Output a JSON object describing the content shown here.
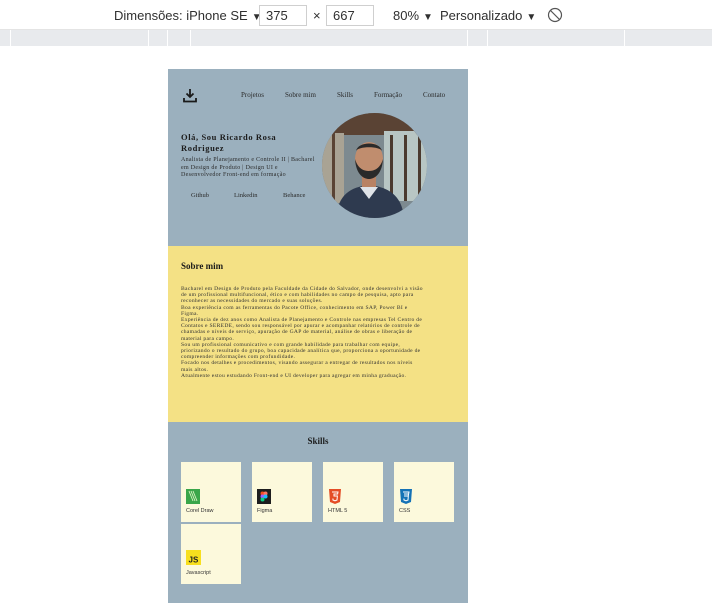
{
  "devtools": {
    "device_label": "Dimensões: iPhone SE",
    "width": "375",
    "height": "667",
    "separator": "×",
    "zoom": "80%",
    "throttle": "Personalizado"
  },
  "site": {
    "nav": [
      "Projetos",
      "Sobre mim",
      "Skills",
      "Formação",
      "Contato"
    ],
    "hero": {
      "title": "Olá, Sou Ricardo Rosa Rodriguez",
      "description": "Analista de Planejamento e Controle II | Bacharel em Design de Produto | Design UI e Desenvolvedor Front-end em formação",
      "social": [
        "Github",
        "Linkedin",
        "Behance"
      ]
    },
    "about": {
      "title": "Sobre mim",
      "paragraphs": [
        "Bacharel em Design de Produto pela Faculdade da Cidade do Salvador, onde desenvolvi a visão de um profissional multifuncional, ético e com habilidades no campo de pesquisa, apto para reconhecer as necessidades do mercado e suas soluções.",
        "Boa experiência com as ferramentas do Pacote Office, conhecimento em SAP, Power BI e Figma.",
        "Experiência de dez anos como Analista de Planejamento e Controle nas empresas Tel Centro de Contatos e SEREDE, sendo sou responsável por apurar e acompanhar relatórios de controle de chamadas e níveis de serviço, apuração de GAP de material, análise de obras e liberação de material para campo.",
        "Sou um profissional comunicativo e com grande habilidade para trabalhar com equipe, priorizando o resultado do grupo, boa capacidade analítica que, proporciona a oportunidade de compreender informações com profundidade.",
        "Focado nos detalhes e procedimentos, visando assegurar a entregar de resultados nos níveis mais altos.",
        "Atualmente estou estudando Front-end e UI developer para agregar em minha graduação."
      ]
    },
    "skills": {
      "title": "Skills",
      "items": [
        {
          "label": "Corel Draw",
          "icon": "coreldraw-icon",
          "color": "#3aa64a"
        },
        {
          "label": "Figma",
          "icon": "figma-icon",
          "color": "#1e1e1e"
        },
        {
          "label": "HTML 5",
          "icon": "html5-icon",
          "color": "#e44d26"
        },
        {
          "label": "CSS",
          "icon": "css3-icon",
          "color": "#1572b6"
        },
        {
          "label": "Javascript",
          "icon": "javascript-icon",
          "color": "#f7df1e"
        }
      ]
    }
  },
  "colors": {
    "hero_bg": "#9bb0be",
    "about_bg": "#f4e185",
    "skill_card_bg": "#fcf9dc"
  }
}
